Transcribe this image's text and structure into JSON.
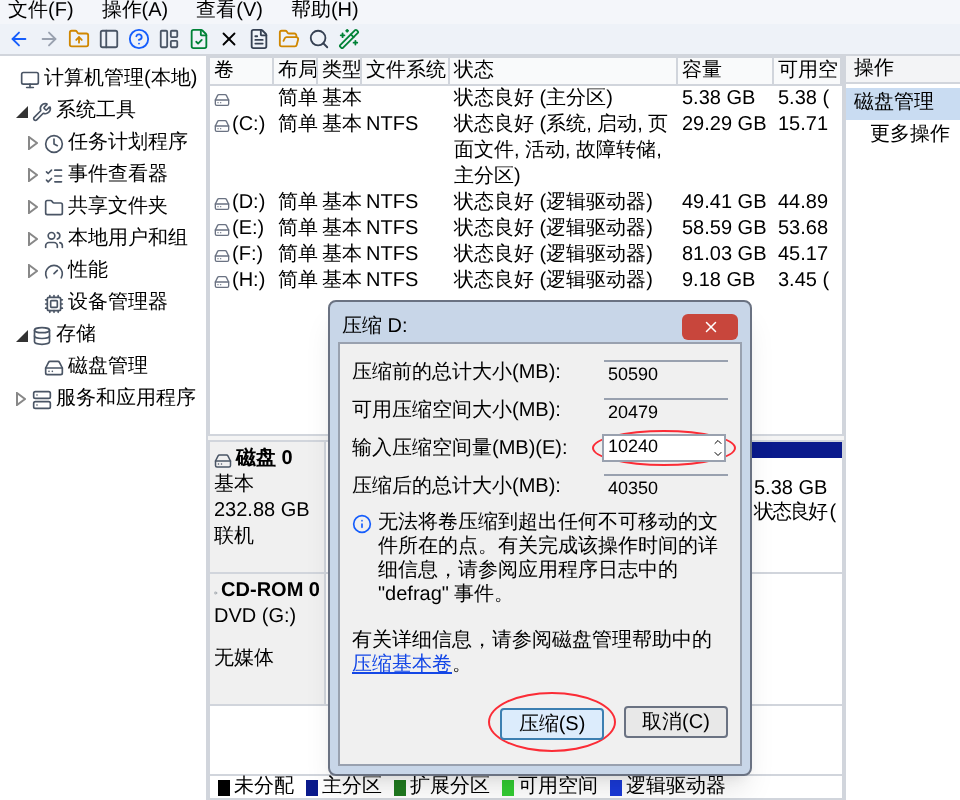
{
  "menu": [
    "文件(F)",
    "操作(A)",
    "查看(V)",
    "帮助(H)"
  ],
  "tree": [
    {
      "label": "计算机管理(本地)",
      "children": [
        {
          "label": "系统工具",
          "expanded": true,
          "children": [
            {
              "label": "任务计划程序",
              "expanded": false
            },
            {
              "label": "事件查看器",
              "expanded": false
            },
            {
              "label": "共享文件夹",
              "expanded": false
            },
            {
              "label": "本地用户和组",
              "expanded": false
            },
            {
              "label": "性能",
              "expanded": false
            },
            {
              "label": "设备管理器"
            }
          ]
        },
        {
          "label": "存储",
          "expanded": true,
          "children": [
            {
              "label": "磁盘管理"
            }
          ]
        },
        {
          "label": "服务和应用程序",
          "expanded": false
        }
      ]
    }
  ],
  "volume_table": {
    "columns": [
      "卷",
      "布局",
      "类型",
      "文件系统",
      "状态",
      "容量",
      "可用空"
    ],
    "rows": [
      {
        "layout": "简单",
        "type": "基本",
        "status": "状态良好 (主分区)",
        "capacity": "5.38 GB",
        "free": "5.38 ("
      },
      {
        "volume": "(C:)",
        "layout": "简单",
        "type": "基本",
        "fs": "NTFS",
        "status": "状态良好 (系统, 启动, 页面文件, 活动, 故障转储, 主分区)",
        "capacity": "29.29 GB",
        "free": "15.71"
      },
      {
        "volume": "(D:)",
        "layout": "简单",
        "type": "基本",
        "fs": "NTFS",
        "status": "状态良好 (逻辑驱动器)",
        "capacity": "49.41 GB",
        "free": "44.89"
      },
      {
        "volume": "(E:)",
        "layout": "简单",
        "type": "基本",
        "fs": "NTFS",
        "status": "状态良好 (逻辑驱动器)",
        "capacity": "58.59 GB",
        "free": "53.68"
      },
      {
        "volume": "(F:)",
        "layout": "简单",
        "type": "基本",
        "fs": "NTFS",
        "status": "状态良好 (逻辑驱动器)",
        "capacity": "81.03 GB",
        "free": "45.17"
      },
      {
        "volume": "(H:)",
        "layout": "简单",
        "type": "基本",
        "fs": "NTFS",
        "status": "状态良好 (逻辑驱动器)",
        "capacity": "9.18 GB",
        "free": "3.45 ("
      }
    ]
  },
  "actions": [
    {
      "kind": "header",
      "label": "操作"
    },
    {
      "kind": "section",
      "label": "磁盘管理"
    },
    {
      "kind": "item",
      "label": "更多操作"
    }
  ],
  "disks": [
    {
      "kind": "disk",
      "name": "磁盘 0",
      "lines": [
        "基本",
        "232.88 GB",
        "联机"
      ],
      "partition": {
        "color": "#0a1a8c",
        "size": "5.38 GB",
        "status": "状态良好 ("
      }
    },
    {
      "kind": "cdrom",
      "name": "CD-ROM 0",
      "lines": [
        "DVD (G:)",
        "无媒体"
      ]
    }
  ],
  "legend": [
    {
      "label": "未分配",
      "color": "#000000"
    },
    {
      "label": "主分区",
      "color": "#0a1a8c"
    },
    {
      "label": "扩展分区",
      "color": "#1f7a1f"
    },
    {
      "label": "可用空间",
      "color": "#33cc33"
    },
    {
      "label": "逻辑驱动器",
      "color": "#1a3ad8"
    }
  ],
  "dialog": {
    "title": "压缩 D:",
    "fields": [
      {
        "kind": "readonly",
        "label": "压缩前的总计大小(MB):",
        "value": "50590"
      },
      {
        "kind": "readonly",
        "label": "可用压缩空间大小(MB):",
        "value": "20479"
      },
      {
        "kind": "spin",
        "label": "输入压缩空间量(MB)(E):",
        "value": "10240"
      },
      {
        "kind": "readonly",
        "label": "压缩后的总计大小(MB):",
        "value": "40350"
      }
    ],
    "info": "无法将卷压缩到超出任何不可移动的文件所在的点。有关完成该操作时间的详细信息，请参阅应用程序日志中的 \"defrag\" 事件。",
    "help_text": "有关详细信息，请参阅磁盘管理帮助中的",
    "help_link": "压缩基本卷",
    "help_end": "。",
    "buttons": [
      {
        "label": "压缩(S)",
        "default": true
      },
      {
        "label": "取消(C)",
        "default": false
      }
    ]
  }
}
